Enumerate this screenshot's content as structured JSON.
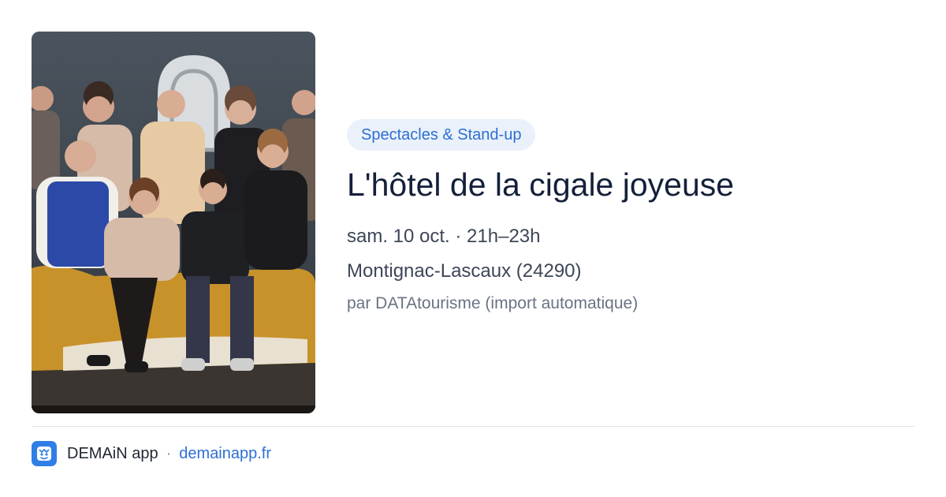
{
  "event": {
    "category": "Spectacles & Stand-up",
    "title": "L'hôtel de la cigale joyeuse",
    "datetime": "sam. 10 oct. · 21h–23h",
    "location": "Montignac-Lascaux (24290)",
    "source": "par DATAtourisme (import automatique)",
    "photo_icon": "troupe-group-photo"
  },
  "footer": {
    "app_name": "DEMAiN app",
    "separator": "·",
    "domain": "demainapp.fr",
    "icon": "demain-app-logo"
  },
  "colors": {
    "accent": "#2d6fd2",
    "chip_bg": "#eaf1fb",
    "title": "#14203a",
    "muted": "#6a7384"
  }
}
